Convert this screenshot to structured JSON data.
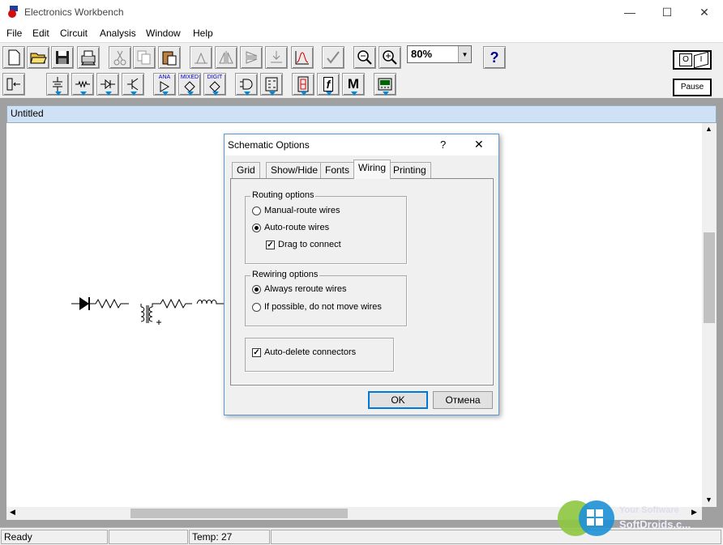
{
  "window": {
    "title": "Electronics Workbench",
    "minimize": "—",
    "maximize": "☐",
    "close": "✕"
  },
  "menu": [
    "File",
    "Edit",
    "Circuit",
    "Analysis",
    "Window",
    "Help"
  ],
  "toolbar": {
    "zoom_value": "80%",
    "help": "?",
    "pause_label": "Pause",
    "power_on": "O",
    "power_off": "I"
  },
  "parts_bin_labels": {
    "analog": "ANA",
    "mixed": "MIXED",
    "digital": "DIGIT",
    "misc": "M",
    "func": "f"
  },
  "document": {
    "title": "Untitled"
  },
  "dialog": {
    "title": "Schematic Options",
    "help": "?",
    "close": "✕",
    "tabs": [
      "Grid",
      "Show/Hide",
      "Fonts",
      "Wiring",
      "Printing"
    ],
    "active_tab": "Wiring",
    "routing": {
      "label": "Routing options",
      "manual": "Manual-route wires",
      "auto": "Auto-route wires",
      "drag": "Drag to connect",
      "selected": "auto",
      "drag_checked": true
    },
    "rewiring": {
      "label": "Rewiring options",
      "always": "Always reroute wires",
      "ifpossible": "If possible, do not move wires",
      "selected": "always"
    },
    "autodelete": {
      "label": "Auto-delete connectors",
      "checked": true
    },
    "ok": "OK",
    "cancel": "Отмена"
  },
  "status": {
    "left": "Ready",
    "temp": "Temp:  27"
  },
  "watermark": {
    "line1": "Your Software",
    "line2": "SoftDroids.c..."
  },
  "colors": {
    "accent": "#0078d7",
    "doc_title_bg": "#cfe2f5"
  }
}
